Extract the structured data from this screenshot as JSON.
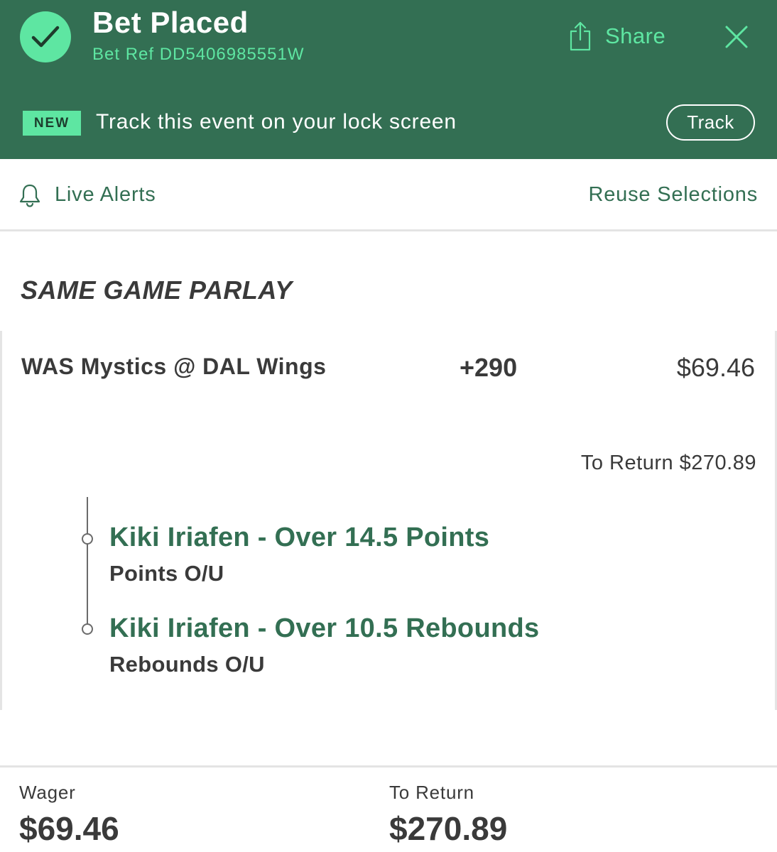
{
  "header": {
    "title": "Bet Placed",
    "bet_ref": "Bet Ref DD5406985551W",
    "share_label": "Share",
    "icons": {
      "status": "check-icon",
      "share": "share-icon",
      "close": "close-icon"
    },
    "colors": {
      "background": "#336f53",
      "accent": "#5ee6a2"
    }
  },
  "banner": {
    "badge": "NEW",
    "text": "Track this event on your lock screen",
    "button": "Track"
  },
  "actions": {
    "live_alerts": "Live Alerts",
    "reuse": "Reuse Selections",
    "bell_icon": "bell-icon"
  },
  "bet": {
    "type": "SAME GAME PARLAY",
    "matchup": "WAS Mystics @ DAL Wings",
    "odds": "+290",
    "stake": "$69.46",
    "to_return": "To Return $270.89",
    "legs": [
      {
        "selection": "Kiki Iriafen - Over 14.5 Points",
        "market": "Points O/U"
      },
      {
        "selection": "Kiki Iriafen - Over 10.5 Rebounds",
        "market": "Rebounds O/U"
      }
    ]
  },
  "footer": {
    "wager_label": "Wager",
    "wager_value": "$69.46",
    "return_label": "To Return",
    "return_value": "$270.89"
  }
}
